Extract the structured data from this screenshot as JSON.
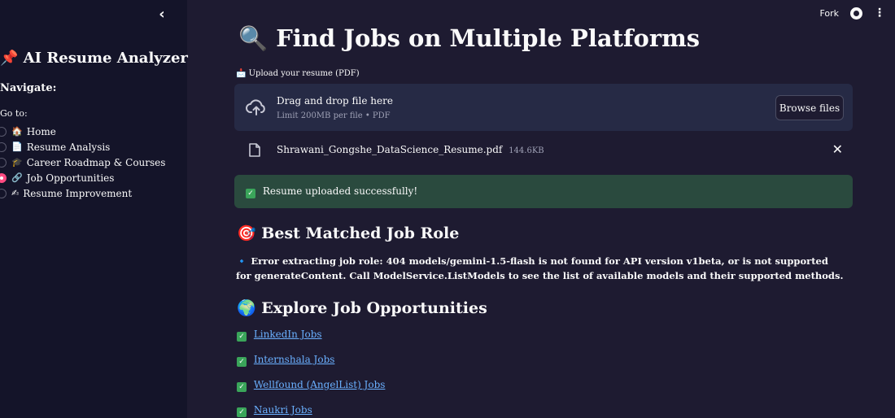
{
  "sidebar": {
    "collapse_glyph": "‹",
    "app_title": "📌 AI Resume Analyzer",
    "nav_heading": "Navigate:",
    "goto_label": "Go to:",
    "items": [
      {
        "emoji": "🏠",
        "label": "Home",
        "selected": false
      },
      {
        "emoji": "📄",
        "label": "Resume Analysis",
        "selected": false
      },
      {
        "emoji": "🎓",
        "label": "Career Roadmap & Courses",
        "selected": false
      },
      {
        "emoji": "🔗",
        "label": "Job Opportunities",
        "selected": true
      },
      {
        "emoji": "✍",
        "label": "Resume Improvement",
        "selected": false
      }
    ]
  },
  "topbar": {
    "fork_label": "Fork",
    "menu_glyph": "⋮"
  },
  "main": {
    "page_title": "🔍 Find Jobs on Multiple Platforms",
    "upload_label": "📩 Upload your resume (PDF)",
    "dropzone": {
      "main_text": "Drag and drop file here",
      "sub_text": "Limit 200MB per file • PDF",
      "browse_label": "Browse files"
    },
    "file": {
      "name": "Shrawani_Gongshe_DataScience_Resume.pdf",
      "size": "144.6KB",
      "close_glyph": "✕"
    },
    "success": {
      "check": "✓",
      "text": "Resume uploaded successfully!"
    },
    "best_role": {
      "emoji": "🎯",
      "heading": "Best Matched Job Role",
      "bullet": "🔹",
      "error": "Error extracting job role: 404 models/gemini-1.5-flash is not found for API version v1beta, or is not supported for generateContent. Call ModelService.ListModels to see the list of available models and their supported methods."
    },
    "explore": {
      "emoji": "🌍",
      "heading": "Explore Job Opportunities",
      "links": [
        {
          "label": "LinkedIn Jobs"
        },
        {
          "label": "Internshala Jobs"
        },
        {
          "label": "Wellfound (AngelList) Jobs"
        },
        {
          "label": "Naukri Jobs"
        }
      ]
    }
  },
  "colors": {
    "main_bg": "#1e1b31",
    "sidebar_bg": "#141429",
    "accent": "#ff4b82",
    "link": "#6ab0ff",
    "success_bg": "#2a4a3e"
  }
}
